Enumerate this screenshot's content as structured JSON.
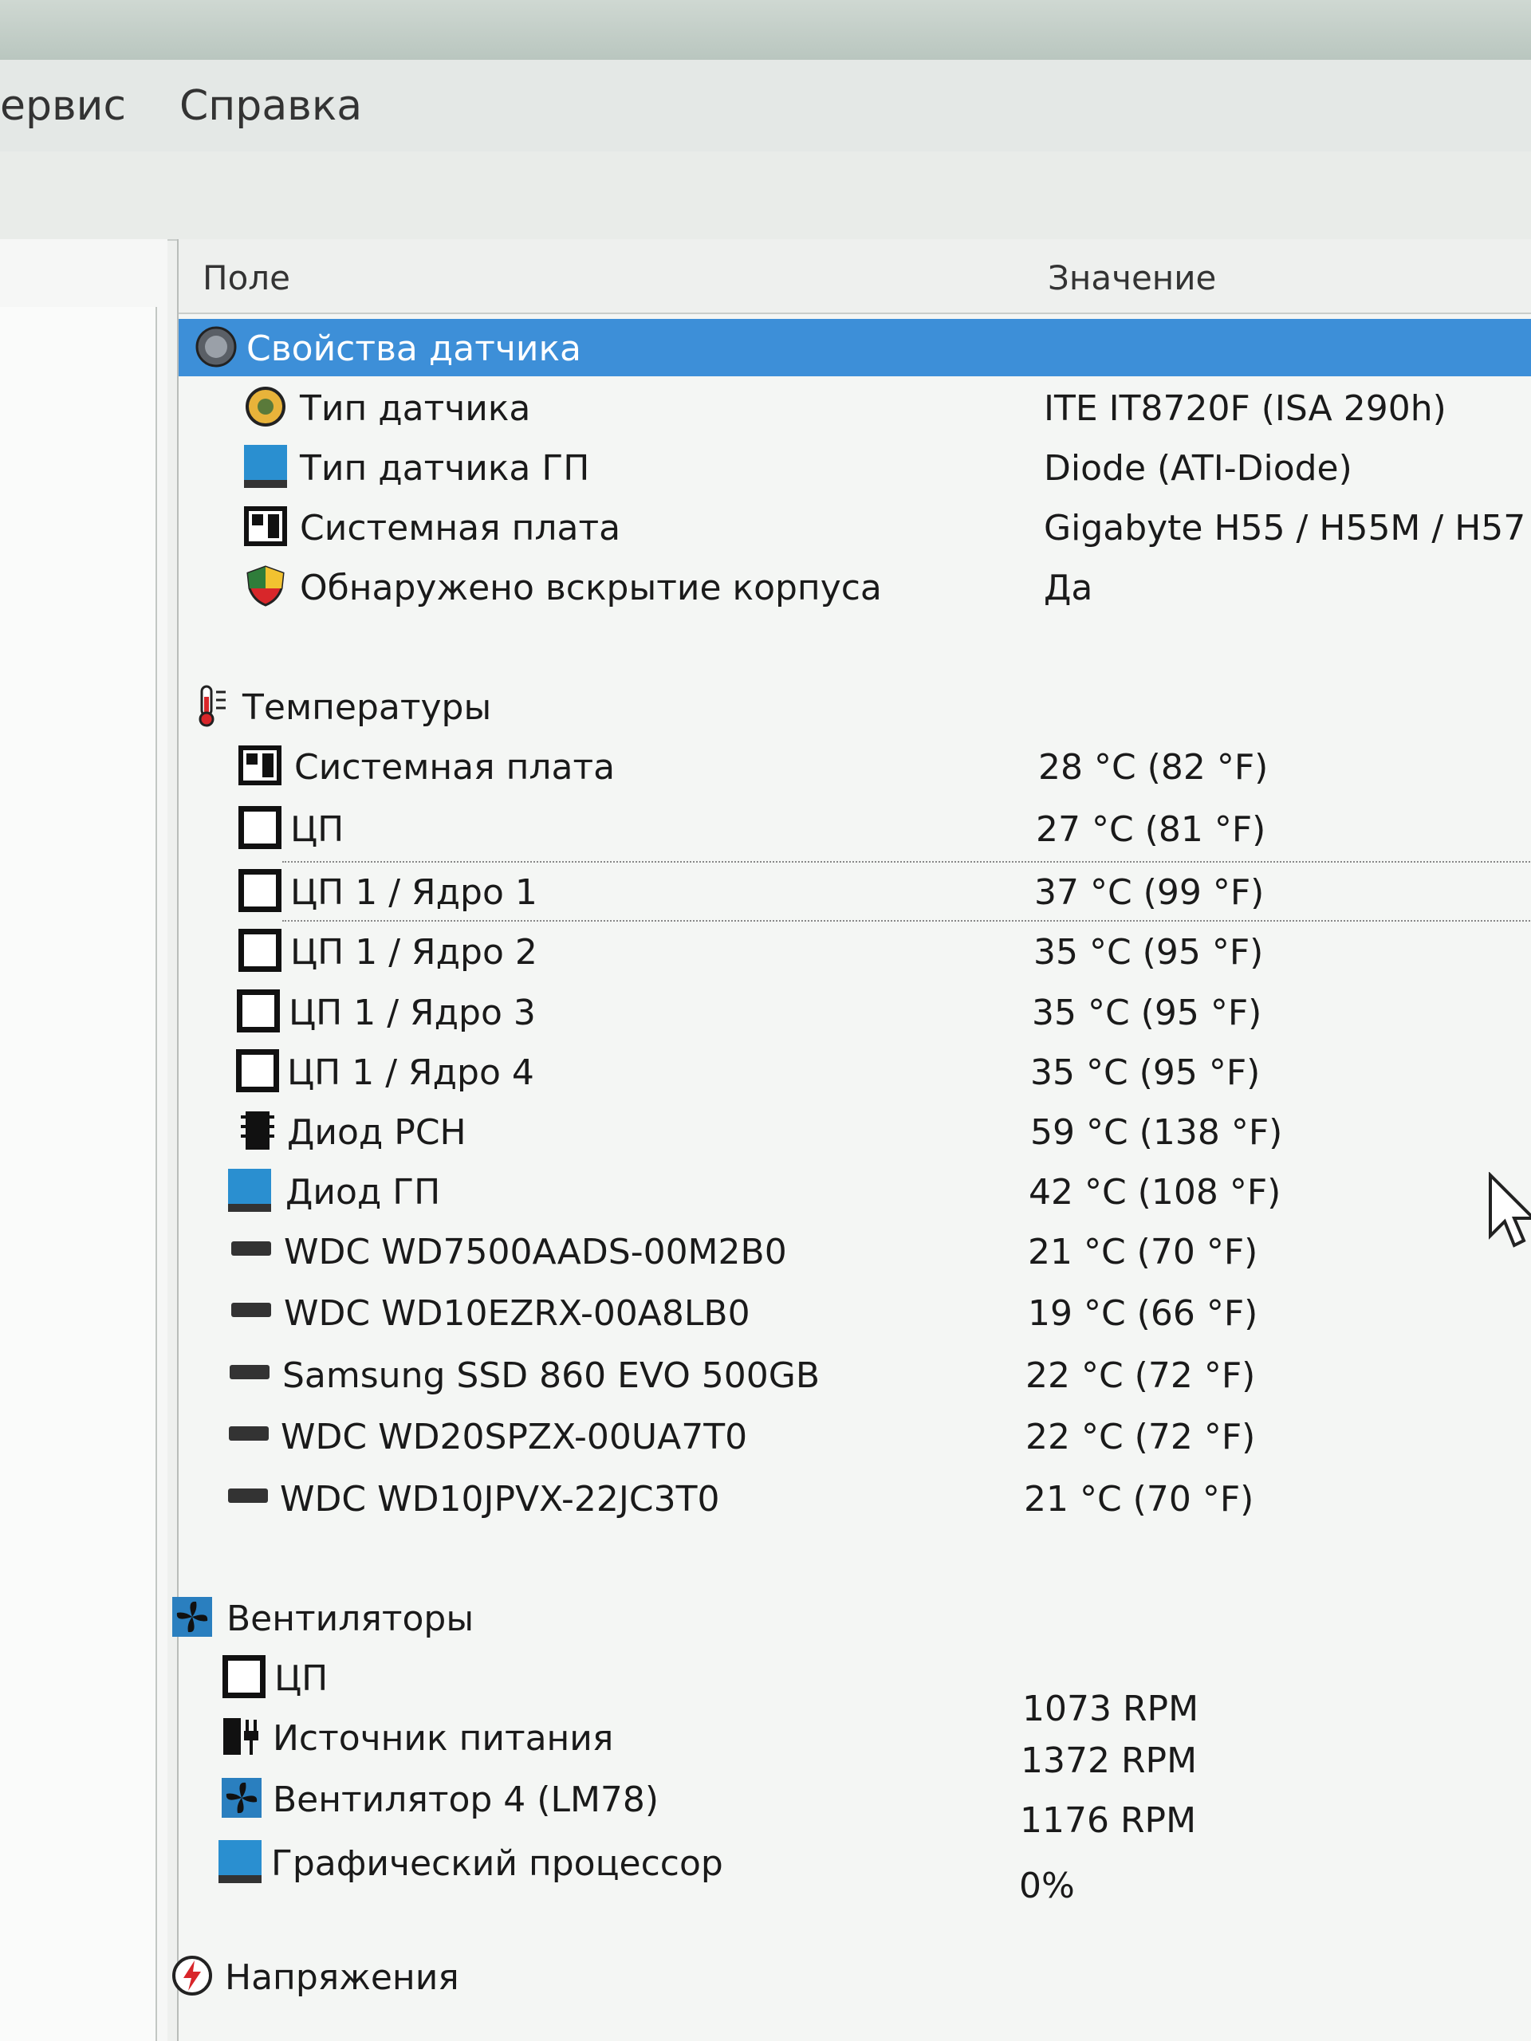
{
  "menu": {
    "service": "ервис",
    "help": "Справка"
  },
  "columns": {
    "field": "Поле",
    "value": "Значение"
  },
  "sensor_group": {
    "label": "Свойства датчика",
    "items": [
      {
        "name": "Тип датчика",
        "value": "ITE IT8720F  (ISA 290h)"
      },
      {
        "name": "Тип датчика ГП",
        "value": "Diode  (ATI-Diode)"
      },
      {
        "name": "Системная плата",
        "value": "Gigabyte H55 / H55M / H57"
      },
      {
        "name": "Обнаружено вскрытие корпуса",
        "value": "Да"
      }
    ]
  },
  "temps_group": {
    "label": "Температуры",
    "items": [
      {
        "name": "Системная плата",
        "value": "28 °C  (82 °F)"
      },
      {
        "name": "ЦП",
        "value": "27 °C  (81 °F)"
      },
      {
        "name": "ЦП 1 / Ядро 1",
        "value": "37 °C  (99 °F)"
      },
      {
        "name": "ЦП 1 / Ядро 2",
        "value": "35 °C  (95 °F)"
      },
      {
        "name": "ЦП 1 / Ядро 3",
        "value": "35 °C  (95 °F)"
      },
      {
        "name": "ЦП 1 / Ядро 4",
        "value": "35 °C  (95 °F)"
      },
      {
        "name": "Диод PCH",
        "value": "59 °C  (138 °F)"
      },
      {
        "name": "Диод ГП",
        "value": "42 °C  (108 °F)"
      },
      {
        "name": "WDC WD7500AADS-00M2B0",
        "value": "21 °C  (70 °F)"
      },
      {
        "name": "WDC WD10EZRX-00A8LB0",
        "value": "19 °C  (66 °F)"
      },
      {
        "name": "Samsung SSD 860 EVO 500GB",
        "value": "22 °C  (72 °F)"
      },
      {
        "name": "WDC WD20SPZX-00UA7T0",
        "value": "22 °C  (72 °F)"
      },
      {
        "name": "WDC WD10JPVX-22JC3T0",
        "value": "21 °C  (70 °F)"
      }
    ]
  },
  "fans_group": {
    "label": "Вентиляторы",
    "items": [
      {
        "name": "ЦП",
        "value": "1073 RPM"
      },
      {
        "name": "Источник питания",
        "value": "1372 RPM"
      },
      {
        "name": "Вентилятор 4 (LM78)",
        "value": "1176 RPM"
      },
      {
        "name": "Графический процессор",
        "value": "0%"
      }
    ]
  },
  "voltage_group": {
    "label": "Напряжения"
  },
  "colors": {
    "selection": "#3d8fd8",
    "text": "#1a1a1a"
  }
}
